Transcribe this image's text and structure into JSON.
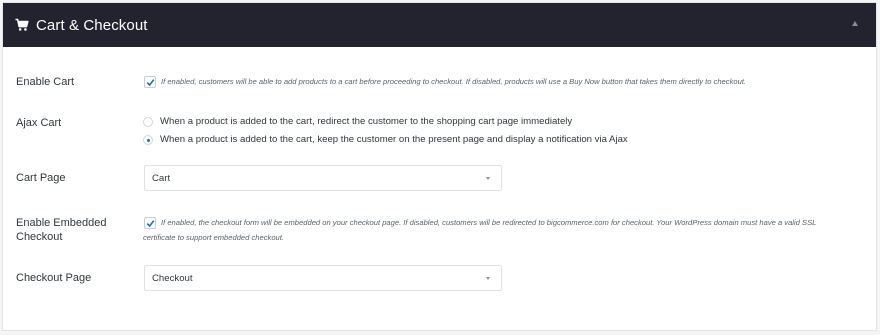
{
  "panel": {
    "title": "Cart & Checkout",
    "icon": "cart-icon",
    "collapse_icon": "chevron-up-icon"
  },
  "enable_cart": {
    "label": "Enable Cart",
    "checked": true,
    "help": "If enabled, customers will be able to add products to a cart before proceeding to checkout. If disabled, products will use a Buy Now button that takes them directly to checkout."
  },
  "ajax_cart": {
    "label": "Ajax Cart",
    "options": [
      {
        "label": "When a product is added to the cart, redirect the customer to the shopping cart page immediately",
        "selected": false
      },
      {
        "label": "When a product is added to the cart, keep the customer on the present page and display a notification via Ajax",
        "selected": true
      }
    ]
  },
  "cart_page": {
    "label": "Cart Page",
    "value": "Cart"
  },
  "embedded_checkout": {
    "label_line1": "Enable Embedded",
    "label_line2": "Checkout",
    "checked": true,
    "help_line1": "If enabled, the checkout form will be embedded on your checkout page. If disabled, customers will be redirected to bigcommerce.com for checkout. Your WordPress domain must have a valid SSL",
    "help_line2": "certificate to support embedded checkout."
  },
  "checkout_page": {
    "label": "Checkout Page",
    "value": "Checkout"
  },
  "colors": {
    "header_bg": "#23232f",
    "accent": "#2271b1",
    "text": "#32373c"
  }
}
